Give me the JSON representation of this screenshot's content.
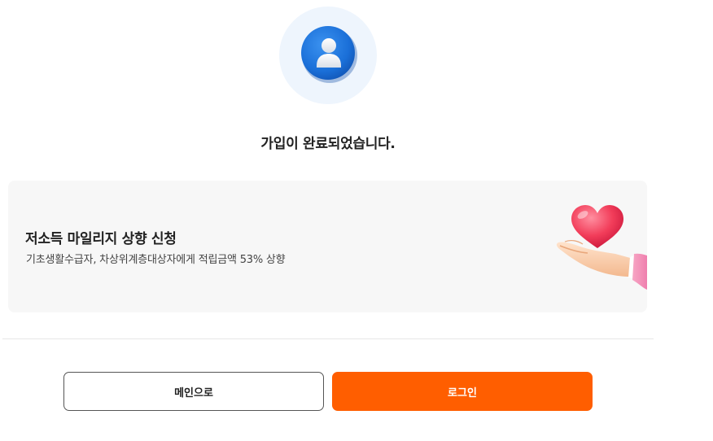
{
  "complete": {
    "icon": "user-avatar-icon",
    "title": "가입이 완료되었습니다."
  },
  "banner": {
    "title": "저소득 마일리지 상향 신청",
    "description": "기초생활수급자, 차상위계층대상자에게 적립금액 53% 상향",
    "illustration": "hand-holding-heart-icon"
  },
  "buttons": {
    "main_label": "메인으로",
    "login_label": "로그인"
  },
  "colors": {
    "accent": "#ff5e00",
    "avatar_blue": "#1e74dc",
    "avatar_bg": "#eef5fd",
    "banner_bg": "#f7f7f7"
  }
}
